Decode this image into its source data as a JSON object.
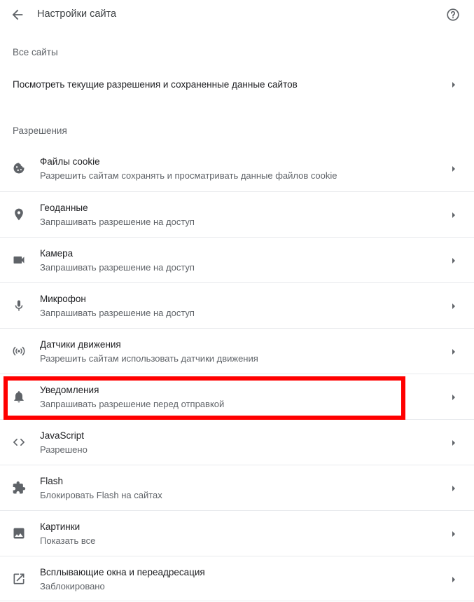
{
  "header": {
    "back_icon": "arrow-back-icon",
    "title": "Настройки сайта",
    "help_icon": "help-icon"
  },
  "all_sites": {
    "section_title": "Все сайты",
    "row_label": "Посмотреть текущие разрешения и сохраненные данные сайтов"
  },
  "permissions": {
    "section_title": "Разрешения",
    "items": [
      {
        "label": "Файлы cookie",
        "sub": "Разрешить сайтам сохранять и просматривать данные файлов cookie",
        "icon": "cookie-icon"
      },
      {
        "label": "Геоданные",
        "sub": "Запрашивать разрешение на доступ",
        "icon": "location-pin-icon"
      },
      {
        "label": "Камера",
        "sub": "Запрашивать разрешение на доступ",
        "icon": "camera-icon"
      },
      {
        "label": "Микрофон",
        "sub": "Запрашивать разрешение на доступ",
        "icon": "microphone-icon"
      },
      {
        "label": "Датчики движения",
        "sub": "Разрешить сайтам использовать датчики движения",
        "icon": "motion-sensors-icon"
      },
      {
        "label": "Уведомления",
        "sub": "Запрашивать разрешение перед отправкой",
        "icon": "bell-icon"
      },
      {
        "label": "JavaScript",
        "sub": "Разрешено",
        "icon": "code-icon"
      },
      {
        "label": "Flash",
        "sub": "Блокировать Flash на сайтах",
        "icon": "puzzle-icon"
      },
      {
        "label": "Картинки",
        "sub": "Показать все",
        "icon": "image-icon"
      },
      {
        "label": "Всплывающие окна и переадресация",
        "sub": "Заблокировано",
        "icon": "open-in-new-icon"
      }
    ]
  },
  "highlight_color": "#ff0000"
}
